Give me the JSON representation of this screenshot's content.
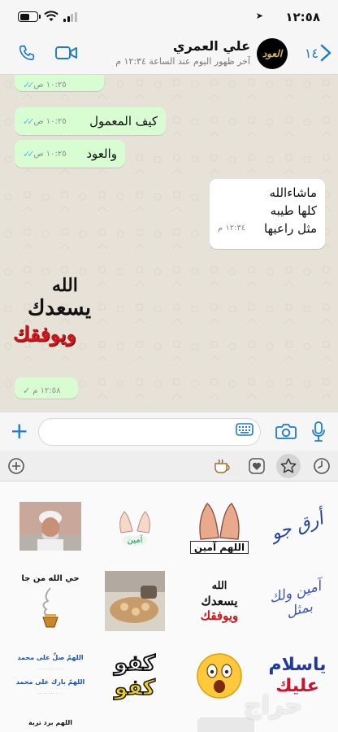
{
  "status_bar": {
    "time": "١٢:٥٨",
    "battery_level": 0.55
  },
  "header": {
    "back_count": "١٤",
    "contact_name": "علي العمري",
    "last_seen": "آخر ظهور اليوم عند الساعة ١٢:٣٤ م",
    "avatar_text": "العود"
  },
  "messages": [
    {
      "dir": "in",
      "text": "",
      "time": "١٠:٢٥ ص",
      "status": "read"
    },
    {
      "dir": "in",
      "text": "كيف المعمول",
      "time": "١٠:٢٥ ص",
      "status": "read"
    },
    {
      "dir": "in",
      "text": "والعود",
      "time": "١٠:٢٥ ص",
      "status": "read"
    },
    {
      "dir": "out",
      "lines": [
        "ماشاءالله",
        "كلها طيبه",
        "مثل راعيها"
      ],
      "time": "١٢:٣٤ م"
    },
    {
      "dir": "in",
      "type": "sticker",
      "lines": [
        "الله",
        "يسعدك",
        "ويوفقك"
      ]
    },
    {
      "dir": "in",
      "text": "",
      "time": "١٢:٥٨ م",
      "status": "sent"
    }
  ],
  "stickers": [
    {
      "id": "s1",
      "caption": ""
    },
    {
      "id": "s2",
      "caption": "آمين"
    },
    {
      "id": "s3",
      "caption": "اللهم آمين"
    },
    {
      "id": "s4",
      "caption": "أرق جو"
    },
    {
      "id": "s5",
      "caption": "حي الله من جا"
    },
    {
      "id": "s6",
      "caption": ""
    },
    {
      "id": "s7",
      "lines": [
        "الله",
        "يسعدك",
        "ويوفقك"
      ]
    },
    {
      "id": "s8",
      "caption": "آمين ولك بمثل"
    },
    {
      "id": "s9",
      "lines": [
        "اللهمّ صلِّ على محمد",
        "اللهمّ بارك على محمد"
      ]
    },
    {
      "id": "s10",
      "lines": [
        "كفو",
        "كفو"
      ]
    },
    {
      "id": "s11",
      "caption": ""
    },
    {
      "id": "s12",
      "lines": [
        "ياسلام",
        "عليك"
      ]
    },
    {
      "id": "s13",
      "caption": "اللهم برد تربة"
    }
  ],
  "watermark": "حراج",
  "colors": {
    "accent": "#1a7bd6",
    "incoming": "#d9fdd3",
    "outgoing": "#ffffff",
    "read_ticks": "#53bdeb"
  }
}
